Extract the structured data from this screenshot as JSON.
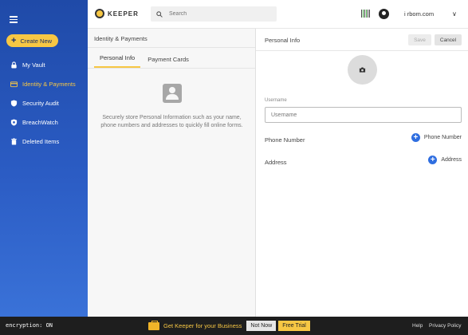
{
  "app": {
    "logo_text": "KEEPER"
  },
  "sidebar": {
    "create_label": "Create New",
    "items": [
      {
        "label": "My Vault",
        "icon": "lock-icon"
      },
      {
        "label": "Identity & Payments",
        "icon": "card-icon",
        "active": true
      },
      {
        "label": "Security Audit",
        "icon": "shield-icon"
      },
      {
        "label": "BreachWatch",
        "icon": "breachwatch-icon"
      },
      {
        "label": "Deleted Items",
        "icon": "trash-icon"
      }
    ]
  },
  "header": {
    "search_placeholder": "Search",
    "user_display": "i        rbom.com",
    "menu_chevron": "∨"
  },
  "list": {
    "title": "Identity & Payments",
    "tabs": [
      "Personal Info",
      "Payment Cards"
    ],
    "empty_text": "Securely store Personal Information such as your name, phone numbers and addresses to quickly fill online forms."
  },
  "detail": {
    "title": "Personal Info",
    "save_label": "Save",
    "cancel_label": "Cancel",
    "username_label": "Username",
    "username_placeholder": "Username",
    "phone_label": "Phone Number",
    "phone_add_label": "Phone Number",
    "address_label": "Address",
    "address_add_label": "Address"
  },
  "footer": {
    "encryption": "encryption: ON",
    "promo": "Get Keeper for your Business",
    "not_now": "Not Now",
    "free_trial": "Free Trial",
    "help": "Help",
    "privacy": "Privacy Policy"
  },
  "colors": {
    "accent": "#f7c744",
    "sidebar": "#2b5cc4",
    "add_blue": "#2f6ee0"
  }
}
